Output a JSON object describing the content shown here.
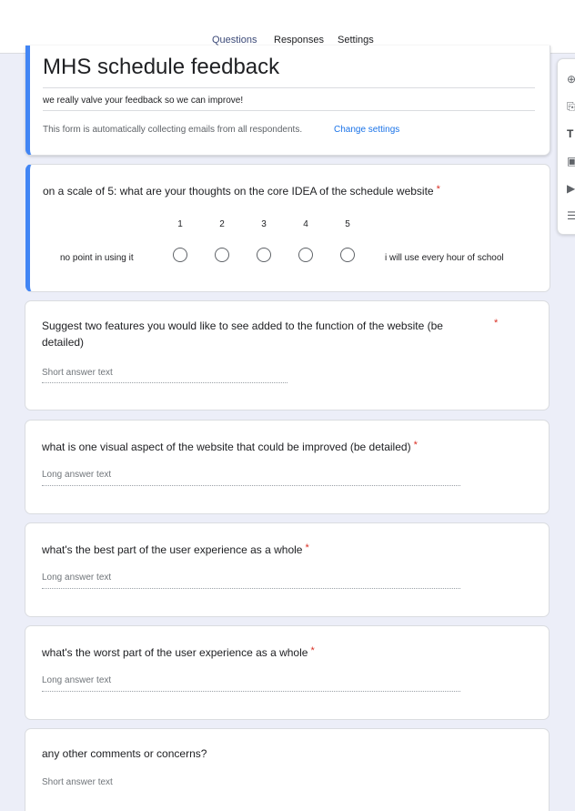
{
  "tabs": [
    {
      "label": "Questions"
    },
    {
      "label": "Responses"
    },
    {
      "label": "Settings"
    }
  ],
  "form": {
    "title": "MHS schedule feedback",
    "description": "we really valve your feedback so we can improve!",
    "email_note": "This form is automatically collecting emails from all respondents.",
    "change_settings": "Change settings"
  },
  "questions": [
    {
      "text": "on a scale of 5: what are your thoughts on the core IDEA of the schedule website",
      "required": "*",
      "scale": [
        "1",
        "2",
        "3",
        "4",
        "5"
      ],
      "low_label": "no point in using it",
      "high_label": "i will use every hour of school"
    },
    {
      "text": "Suggest two features you would like to see added to the function of the website  (be detailed)",
      "required": "*",
      "answer_hint": "Short answer text"
    },
    {
      "text": "what is one visual aspect of the website that could be improved (be detailed)",
      "required": "*",
      "answer_hint": "Long answer text"
    },
    {
      "text": "what's the best part of the user experience as a whole",
      "required": "*",
      "answer_hint": "Long answer text"
    },
    {
      "text": "what's the worst part of the user experience as a whole",
      "required": "*",
      "answer_hint": "Long answer text"
    },
    {
      "text": "any other comments or concerns?",
      "answer_hint": "Short answer text"
    }
  ],
  "toolbar": {
    "icons": [
      "add-question-icon",
      "import-questions-icon",
      "add-title-icon",
      "add-image-icon",
      "add-video-icon",
      "add-section-icon"
    ],
    "glyphs": [
      "⊕",
      "⎘",
      "T",
      "▣",
      "▶",
      "☰"
    ]
  },
  "colors": {
    "accent": "#3c4a78",
    "selected_bar": "#4285f4",
    "required": "#d93025",
    "link": "#1a73e8",
    "background": "#eceef8"
  }
}
